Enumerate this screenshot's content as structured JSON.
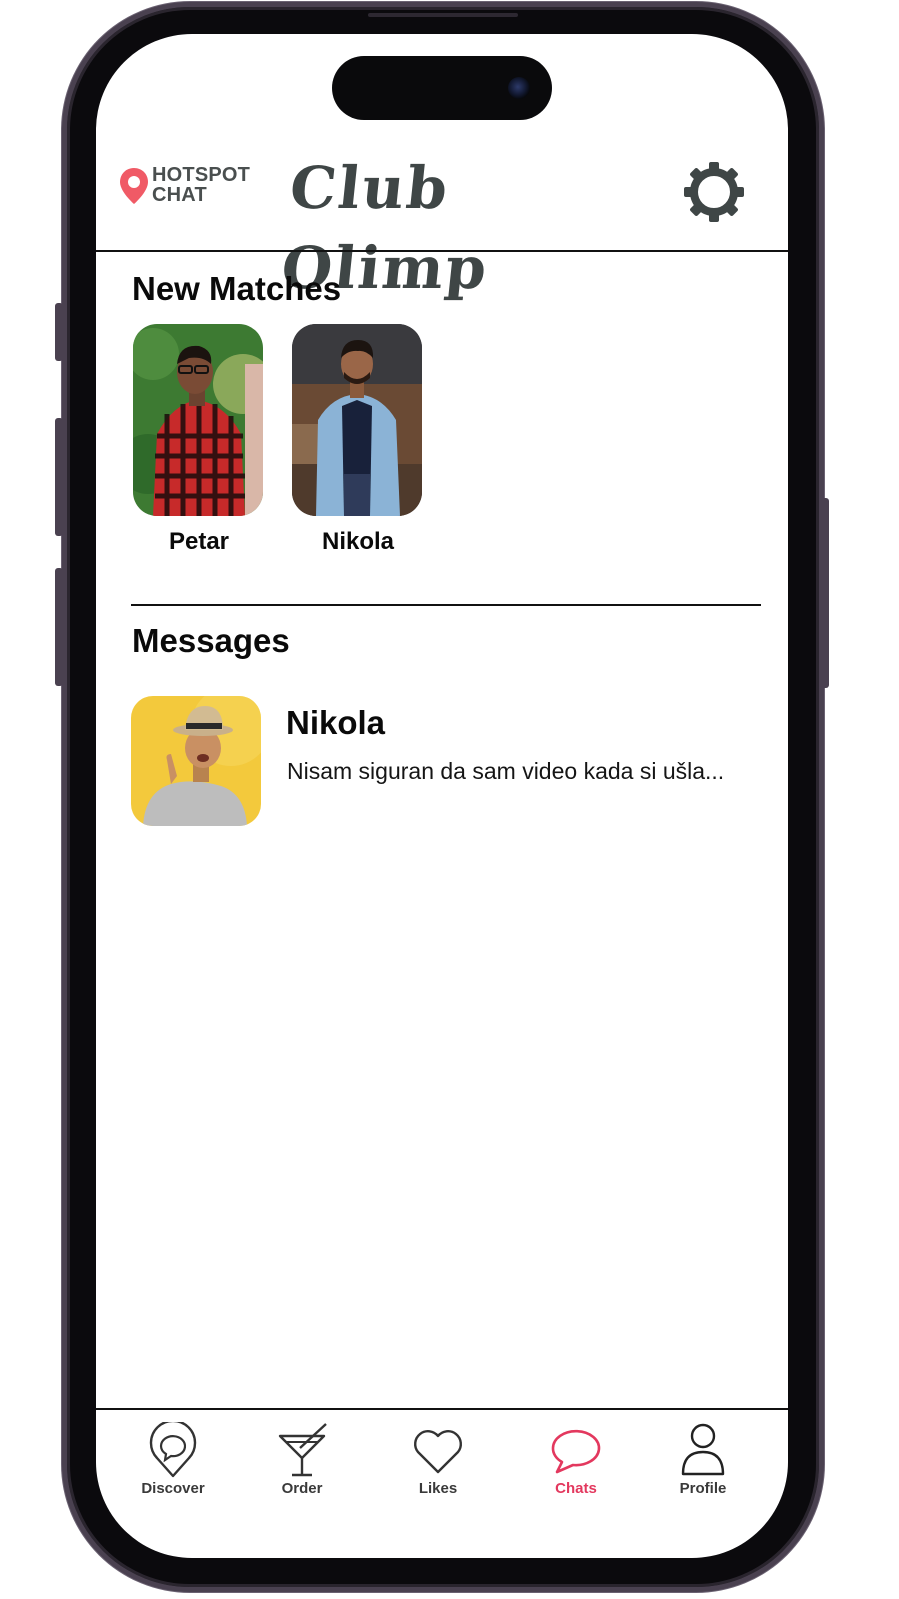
{
  "brand": {
    "line1": "HOTSPOT",
    "line2": "CHAT",
    "pin_color": "#f05a66"
  },
  "header": {
    "title": "Club Olimp",
    "settings_icon": "gear-icon"
  },
  "new_matches": {
    "title": "New Matches",
    "items": [
      {
        "name": "Petar"
      },
      {
        "name": "Nikola"
      }
    ]
  },
  "messages": {
    "title": "Messages",
    "items": [
      {
        "name": "Nikola",
        "preview": "Nisam siguran da sam video kada si ušla..."
      }
    ]
  },
  "nav": {
    "items": [
      {
        "label": "Discover",
        "icon": "chat-pin-icon"
      },
      {
        "label": "Order",
        "icon": "cocktail-icon"
      },
      {
        "label": "Likes",
        "icon": "heart-icon"
      },
      {
        "label": "Chats",
        "icon": "chat-bubble-icon",
        "active": true
      },
      {
        "label": "Profile",
        "icon": "user-icon"
      }
    ],
    "active_color": "#e3385e"
  }
}
